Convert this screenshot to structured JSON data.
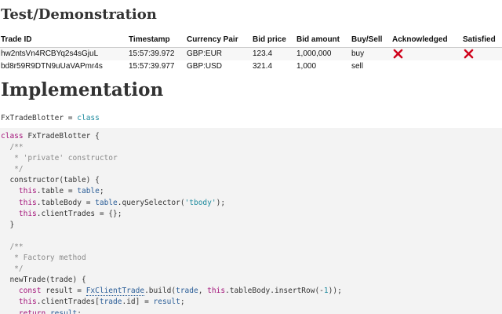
{
  "headings": {
    "test": "Test/Demonstration",
    "implementation": "Implementation"
  },
  "blotter": {
    "columns": [
      "Trade ID",
      "Timestamp",
      "Currency Pair",
      "Bid price",
      "Bid amount",
      "Buy/Sell",
      "Acknowledged",
      "Satisfied"
    ],
    "rows": [
      {
        "trade_id": "hw2ntsVn4RCBYq2s4sGjuL",
        "timestamp": "15:57:39.972",
        "pair": "GBP:EUR",
        "bid_price": "123.4",
        "bid_amount": "1,000,000",
        "side": "buy",
        "acknowledged": "cross",
        "satisfied": "cross"
      },
      {
        "trade_id": "bd8r59R9DTN9uUaVAPmr4s",
        "timestamp": "15:57:39.977",
        "pair": "GBP:USD",
        "bid_price": "321.4",
        "bid_amount": "1,000",
        "side": "sell",
        "acknowledged": "",
        "satisfied": ""
      }
    ],
    "cross_color": "#d0021b"
  },
  "declaration": {
    "name": "FxTradeBlotter",
    "equals": " = ",
    "value": "class"
  },
  "code": {
    "l1_kw": "class",
    "l1_rest": " FxTradeBlotter {",
    "l2": "  /**",
    "l3": "   * 'private' constructor",
    "l4": "   */",
    "l5": "  constructor(table) {",
    "l6_this": "this",
    "l6_mid": ".table = ",
    "l6_var": "table",
    "l6_end": ";",
    "l7_this": "this",
    "l7_mid": ".tableBody = ",
    "l7_var": "table",
    "l7_call": ".querySelector(",
    "l7_str": "'tbody'",
    "l7_end": ");",
    "l8_this": "this",
    "l8_end": ".clientTrades = {};",
    "l9": "  }",
    "l10": "",
    "l11": "  /**",
    "l12": "   * Factory method",
    "l13": "   */",
    "l14": "  newTrade(trade) {",
    "l15_kw": "const",
    "l15_mid": " result = ",
    "l15_cls": "FxClientTrade",
    "l15_call": ".build(",
    "l15_var": "trade",
    "l15_sep": ", ",
    "l15_this": "this",
    "l15_rest": ".tableBody.insertRow(-",
    "l15_num": "1",
    "l15_end": "));",
    "l16_this": "this",
    "l16_mid": ".clientTrades[",
    "l16_var": "trade",
    "l16_end": ".id] = ",
    "l16_var2": "result",
    "l16_end2": ";",
    "l17_kw": "return",
    "l17_sp": " ",
    "l17_var": "result",
    "l17_end": ";"
  }
}
